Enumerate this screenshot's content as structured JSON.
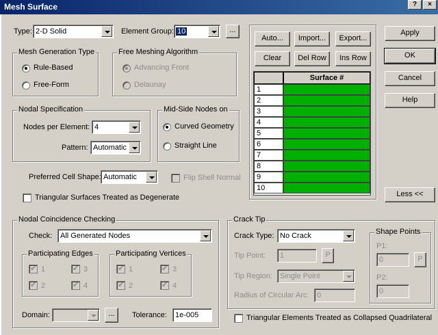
{
  "window": {
    "title": "Mesh Surface"
  },
  "top": {
    "type_label": "Type:",
    "type_value": "2-D Solid",
    "group_label": "Element Group:",
    "group_value": "10",
    "group_more": "..."
  },
  "mesh_gen": {
    "title": "Mesh Generation Type",
    "opt1": "Rule-Based",
    "opt2": "Free-Form"
  },
  "free_mesh": {
    "title": "Free Meshing Algorithm",
    "opt1": "Advancing Front",
    "opt2": "Delaunay"
  },
  "nodal": {
    "title": "Nodal Specification",
    "npe_label": "Nodes per Element:",
    "npe_value": "4",
    "pattern_label": "Pattern:",
    "pattern_value": "Automatic"
  },
  "midside": {
    "title": "Mid-Side Nodes on",
    "opt1": "Curved Geometry",
    "opt2": "Straight Line"
  },
  "cell": {
    "shape_label": "Preferred Cell Shape:",
    "shape_value": "Automatic",
    "flip": "Flip Shell Normal",
    "tri_degen": "Triangular Surfaces Treated as Degenerate"
  },
  "table": {
    "buttons": [
      "Auto...",
      "Import...",
      "Export...",
      "Clear",
      "Del Row",
      "Ins Row"
    ],
    "header": "Surface #",
    "rows": [
      "1",
      "2",
      "3",
      "4",
      "5",
      "6",
      "7",
      "8",
      "9",
      "10"
    ],
    "fill_color": "#00b000"
  },
  "side": {
    "apply": "Apply",
    "ok": "OK",
    "cancel": "Cancel",
    "help": "Help",
    "less": "Less <<"
  },
  "coincidence": {
    "title": "Nodal Coincidence Checking",
    "check_label": "Check:",
    "check_value": "All Generated Nodes",
    "edges_title": "Participating Edges",
    "edges": [
      "1",
      "3",
      "2",
      "4"
    ],
    "verts_title": "Participating Vertices",
    "verts": [
      "1",
      "3",
      "2",
      "4"
    ],
    "domain_label": "Domain:",
    "domain_more": "...",
    "tol_label": "Tolerance:",
    "tol_value": "1e-005"
  },
  "crack": {
    "title": "Crack Tip",
    "type_label": "Crack Type:",
    "type_value": "No Crack",
    "tip_point_label": "Tip Point:",
    "tip_point_value": "1",
    "p_btn": "P",
    "tip_region_label": "Tip Region:",
    "tip_region_value": "Single Point",
    "radius_label": "Radius of Circular Arc:",
    "radius_value": "0",
    "shape_title": "Shape Points",
    "p1_label": "P1:",
    "p1_value": "0",
    "p2_label": "P2:",
    "p2_value": "0",
    "tri_collapsed": "Triangular Elements Treated as Collapsed Quadrilateral"
  }
}
